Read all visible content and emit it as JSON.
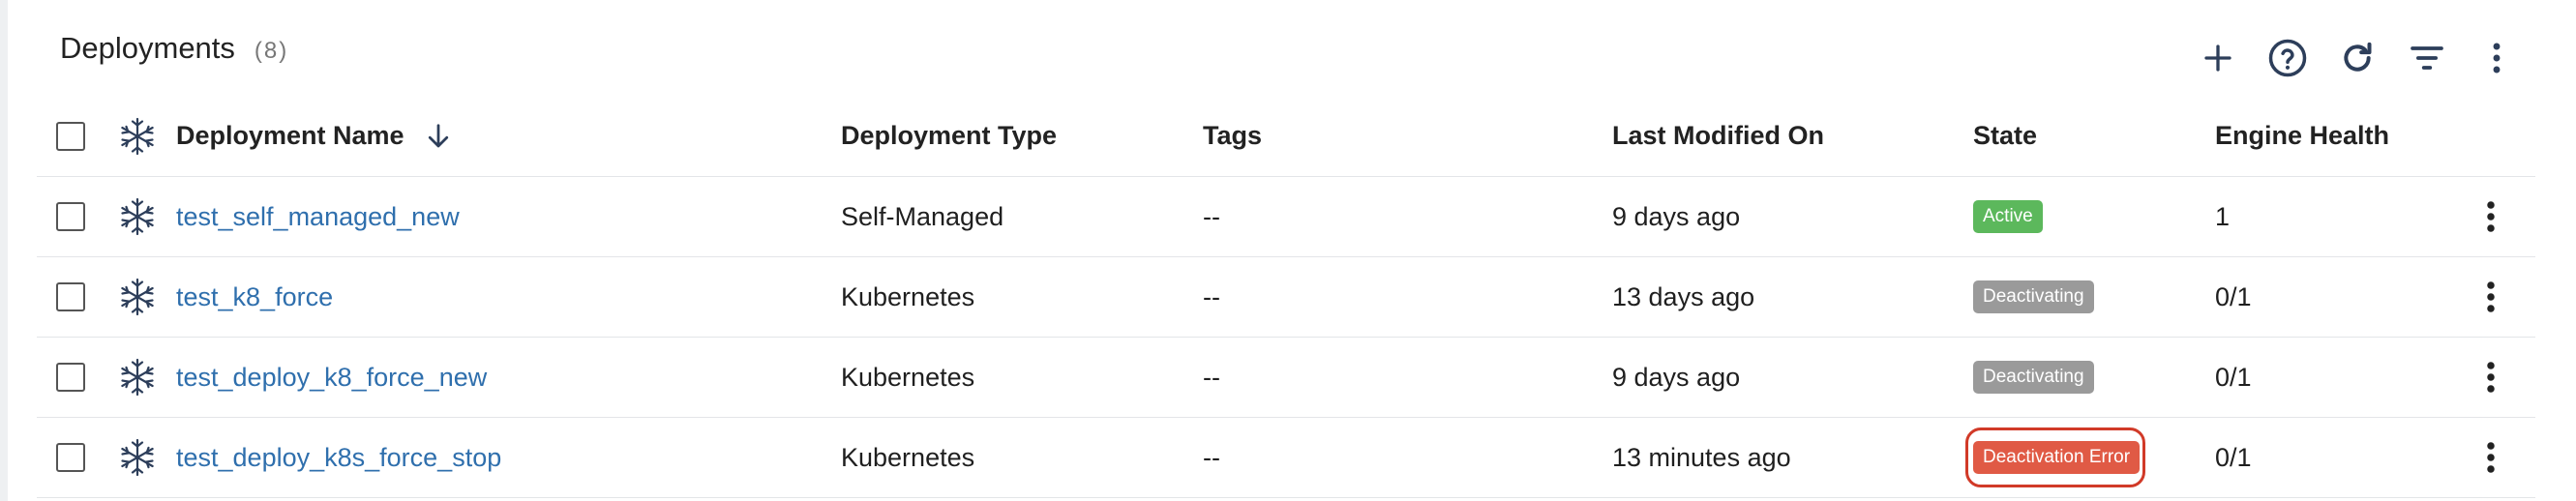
{
  "header": {
    "title": "Deployments",
    "count": "(8)"
  },
  "toolbar": {
    "add_icon": "plus-icon",
    "help_icon": "help-circle-icon",
    "refresh_icon": "refresh-icon",
    "filter_icon": "filter-icon",
    "more_icon": "kebab-menu-icon"
  },
  "table": {
    "columns": {
      "name": "Deployment Name",
      "type": "Deployment Type",
      "tags": "Tags",
      "modified": "Last Modified On",
      "state": "State",
      "health": "Engine Health"
    },
    "sort": "descending",
    "rows": [
      {
        "name": "test_self_managed_new",
        "type": "Self-Managed",
        "tags": "--",
        "modified": "9 days ago",
        "state": "Active",
        "state_kind": "active",
        "health": "1"
      },
      {
        "name": "test_k8_force",
        "type": "Kubernetes",
        "tags": "--",
        "modified": "13 days ago",
        "state": "Deactivating",
        "state_kind": "deactivating",
        "health": "0/1"
      },
      {
        "name": "test_deploy_k8_force_new",
        "type": "Kubernetes",
        "tags": "--",
        "modified": "9 days ago",
        "state": "Deactivating",
        "state_kind": "deactivating",
        "health": "0/1"
      },
      {
        "name": "test_deploy_k8s_force_stop",
        "type": "Kubernetes",
        "tags": "--",
        "modified": "13 minutes ago",
        "state": "Deactivation Error",
        "state_kind": "error",
        "health": "0/1"
      }
    ]
  },
  "colors": {
    "link": "#2f6fad",
    "active": "#5cb85c",
    "deactivating": "#9a9a9a",
    "error": "#e05a45",
    "highlight": "#d13a28",
    "icon": "#2d3e5a"
  }
}
